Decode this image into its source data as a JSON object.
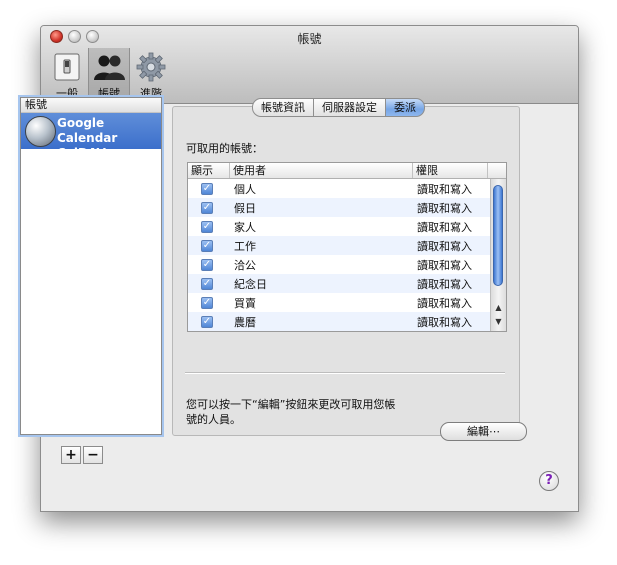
{
  "window": {
    "title": "帳號"
  },
  "toolbar": {
    "items": [
      {
        "label": "一般",
        "icon": "switch-icon",
        "selected": false
      },
      {
        "label": "帳號",
        "icon": "accounts-icon",
        "selected": true
      },
      {
        "label": "進階",
        "icon": "gear-icon",
        "selected": false
      }
    ]
  },
  "sidebar": {
    "header": "帳號",
    "accounts": [
      {
        "line1": "Google Calendar",
        "line2": "CalDAV",
        "icon": "globe-icon"
      }
    ],
    "add_label": "+",
    "remove_label": "−"
  },
  "tabs": [
    {
      "label": "帳號資訊",
      "active": false
    },
    {
      "label": "伺服器設定",
      "active": false
    },
    {
      "label": "委派",
      "active": true
    }
  ],
  "delegation": {
    "available_label": "可取用的帳號：",
    "columns": [
      "顯示",
      "使用者",
      "權限"
    ],
    "rows": [
      {
        "user": "個人",
        "permission": "讀取和寫入",
        "shown": true
      },
      {
        "user": "假日",
        "permission": "讀取和寫入",
        "shown": true
      },
      {
        "user": "家人",
        "permission": "讀取和寫入",
        "shown": true
      },
      {
        "user": "工作",
        "permission": "讀取和寫入",
        "shown": true
      },
      {
        "user": "洽公",
        "permission": "讀取和寫入",
        "shown": true
      },
      {
        "user": "紀念日",
        "permission": "讀取和寫入",
        "shown": true
      },
      {
        "user": "買賣",
        "permission": "讀取和寫入",
        "shown": true
      },
      {
        "user": "農曆",
        "permission": "讀取和寫入",
        "shown": true
      }
    ],
    "check_glyph": "✓",
    "hint_line1": "您可以按一下“編輯”按鈕來更改可取用您帳",
    "hint_line2": "號的人員。",
    "edit_button": "編輯⋯"
  },
  "help": {
    "label": "?"
  },
  "colors": {
    "selection": "#3c6fcb",
    "accent": "#77a6e6",
    "help": "#7a1fb5"
  }
}
